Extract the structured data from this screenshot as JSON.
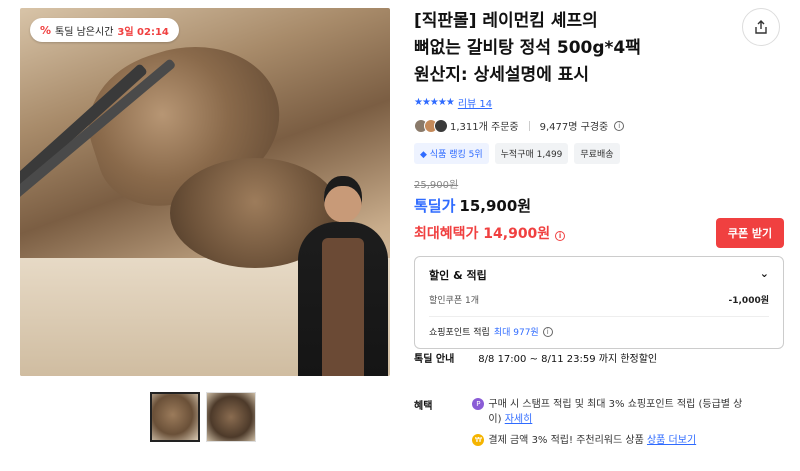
{
  "timer": {
    "label": "톡딜 남은시간",
    "value": "3일 02:14",
    "icon": "percent-icon"
  },
  "product": {
    "title_lines": [
      "[직판몰] 레이먼킴 셰프의",
      "뼈없는 갈비탕 정석 500g*4팩",
      "원산지: 상세설명에 표시"
    ],
    "rating_stars": "★★★★★",
    "review_label": "리뷰 14",
    "orders": "1,311개 주문중",
    "watching": "9,477명 구경중",
    "tags": [
      "식품 랭킹 5위",
      "누적구매 1,499",
      "무료배송"
    ],
    "original_price": "25,900원",
    "price_label": "톡딜가",
    "price": "15,900원",
    "max_benefit": "최대혜택가 14,900원",
    "coupon_button": "쿠폰 받기"
  },
  "discount_box": {
    "title": "할인 & 적립",
    "coupon_label": "할인쿠폰 1개",
    "coupon_value": "-1,000원",
    "points_label": "쇼핑포인트 적립",
    "points_value": "최대 977원"
  },
  "deal": {
    "label": "톡딜 안내",
    "text": "8/8 17:00 ~ 8/11 23:59 까지 한정할인"
  },
  "perks": {
    "label": "혜택",
    "item1_text": "구매 시 스탬프 적립 및 최대 3% 쇼핑포인트 적립 (등급별 상이)",
    "item1_link": "자세히",
    "item2_text": "결제 금액 3% 적립! 주천리워드 상품",
    "item2_link": "상품 더보기"
  },
  "colors": {
    "accent_blue": "#2f6bff",
    "accent_red": "#f04040"
  }
}
